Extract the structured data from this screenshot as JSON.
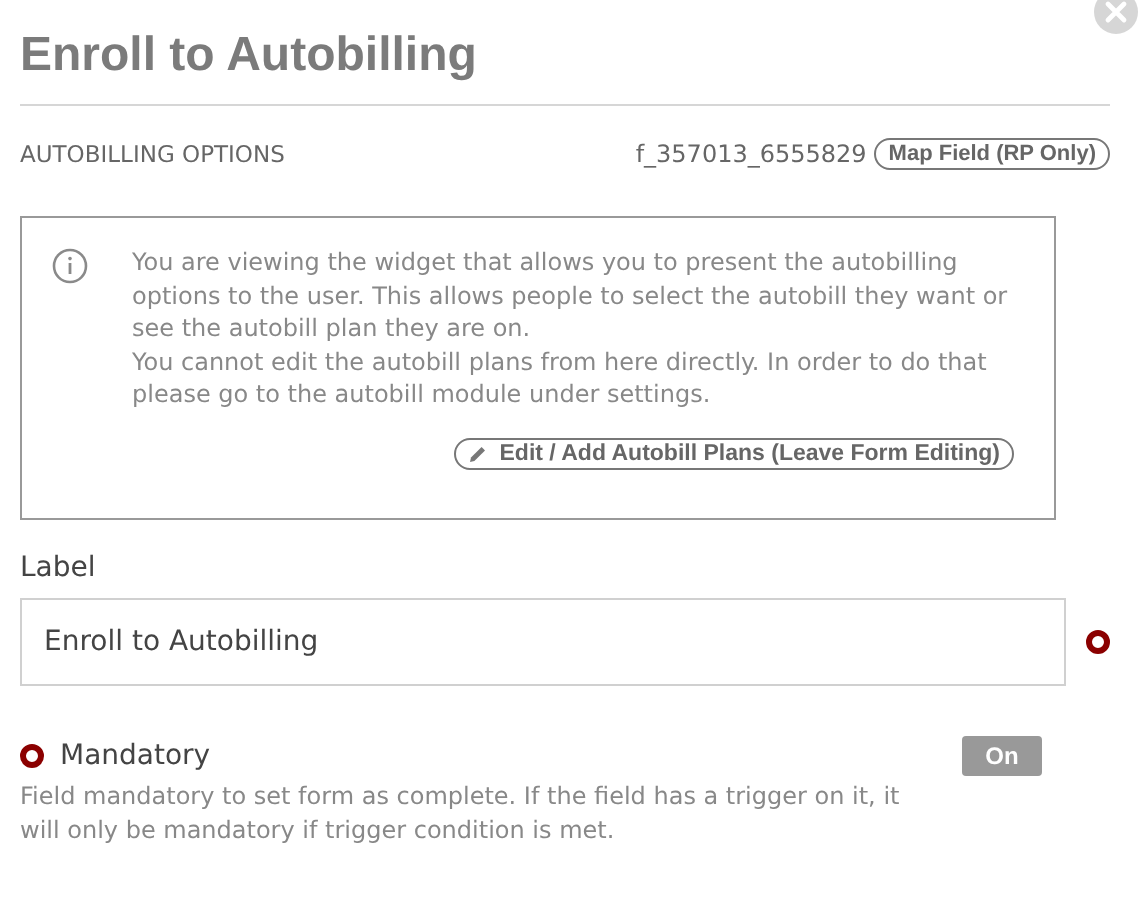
{
  "title": "Enroll to Autobilling",
  "section": {
    "heading": "AUTOBILLING OPTIONS",
    "field_id": "f_357013_6555829",
    "map_button": "Map Field (RP Only)"
  },
  "info": {
    "paragraphs": [
      "You are viewing the widget that allows you to present the autobilling options to the user. This allows people to select the autobill they want or see the autobill plan they are on.",
      "You cannot edit the autobill plans from here directly. In order to do that please go to the autobill module under settings."
    ],
    "button": "Edit / Add Autobill Plans (Leave Form Editing)"
  },
  "label_field": {
    "label": "Label",
    "value": "Enroll to Autobilling"
  },
  "mandatory": {
    "label": "Mandatory",
    "toggle": "On",
    "on": true,
    "description": "Field mandatory to set form as complete. If the field has a trigger on it, it will only be mandatory if trigger condition is met."
  }
}
